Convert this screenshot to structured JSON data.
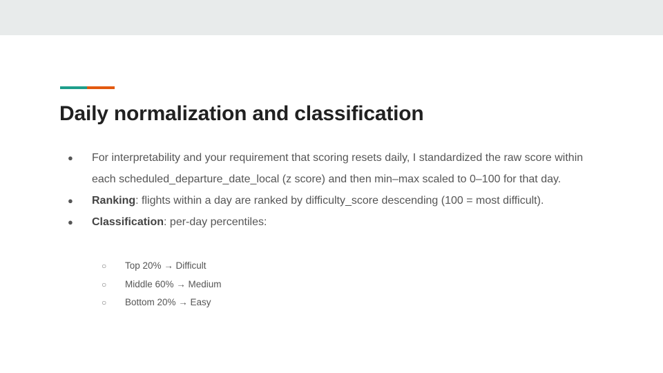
{
  "slide": {
    "title": "Daily normalization and classification",
    "bullets": {
      "b1": {
        "text": "For interpretability and your requirement that scoring resets daily, I standardized the raw score within each scheduled_departure_date_local (z score) and then min–max scaled to 0–100 for that day."
      },
      "b2": {
        "label": "Ranking",
        "text": ": flights within a day are ranked by difficulty_score descending (100 = most difficult)."
      },
      "b3": {
        "label": "Classification",
        "text": ": per-day percentiles:",
        "sub": [
          "Top 20% → Difficult",
          "Middle 60% → Medium",
          "Bottom 20% → Easy"
        ]
      }
    },
    "accent_colors": [
      "#1e9e8b",
      "#e2590f"
    ],
    "bullet_symbol": "●",
    "sub_bullet_symbol": "○"
  }
}
